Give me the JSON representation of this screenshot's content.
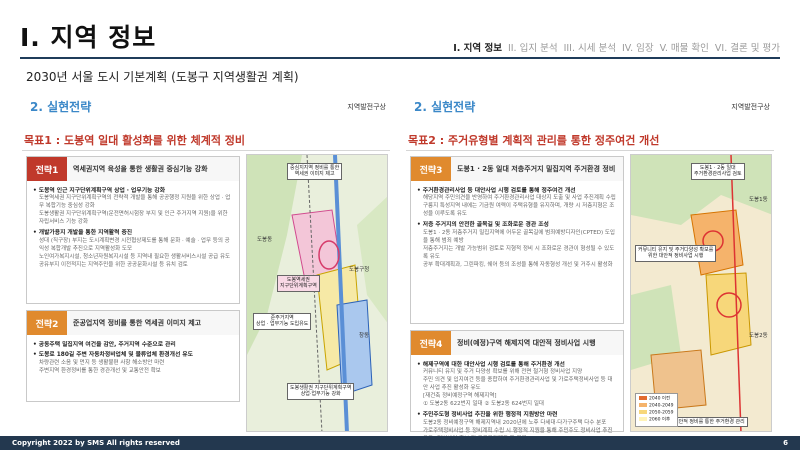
{
  "header": {
    "title": "I. 지역 정보",
    "nav": [
      "I. 지역 정보",
      "II. 입지 분석",
      "III. 시세 분석",
      "IV. 임장",
      "V. 매물 확인",
      "VI. 결론 및 평가"
    ]
  },
  "subtitle": "2030년 서울 도시 기본계획 (도봉구 지역생활권 계획)",
  "left": {
    "strategy": "2. 실현전략",
    "tag": "지역발전구상",
    "goal": "목표1 : 도봉역 일대 활성화를 위한 체계적 정비",
    "box1": {
      "num": "전략1",
      "name": "역세권지역 육성을 통한 생활권 중심기능 강화",
      "items": [
        "도봉역 인근 지구단위계획구역 상업 · 업무기능 강화",
        "도봉역세권 지구단위계획구역의 전략적 개발을 통해 공공행정 지원을 위한 상업 · 업무 복합기능 중심성 강화",
        "도봉생활권 지구단위계획구역(운전면허시험장 부지 및 인근 주거지역 지원)을 위한 자립서비스 기능 강화",
        "개발가용지 개발을 통한 지역활력 증진",
        "성대 (직구장) 부지는 도시계획변경 시전협상제도를 통해 문화 · 예술 · 업무 등의 공익성 복합개발 추진으로 지역활성화 도모",
        "노인여가복지시설, 청소년자원복지시설 등 지역내 필요한 생활서비스시설 공급 유도",
        "공유부지 이전적지는 지역주민을 위한 공공문화시설 등 유치 검토"
      ]
    },
    "box2": {
      "num": "전략2",
      "name": "준공업지역 정비를 통한 역세권 이미지 제고",
      "items": [
        "공동주택 밀집지역 여건을 감안, 주거지역 수준으로 관리",
        "도봉로 180길 주변 자동차정비업체 및 물류업체 환경개선 유도",
        "차량관련 소음 및 먼지 등 생활불편 사항 해소방안 마련",
        "주변지역 환경정비를 통한 경관개선 및 교통안전 확보"
      ]
    },
    "map": {
      "labels": [
        "중심지지역 정비를 통한\n역세권 이미지 제고",
        "준주거지역\n상업 · 업무기능 도입유도",
        "도봉역세권\n지구단위계획구역",
        "도봉생활권 지구단위계획구역\n상업·업무기능 강화",
        "도봉구청",
        "도봉동",
        "창동"
      ]
    }
  },
  "right": {
    "strategy": "2. 실현전략",
    "tag": "지역발전구상",
    "goal": "목표2 : 주거유형별 계획적 관리를 통한 정주여건 개선",
    "box3": {
      "num": "전략3",
      "name": "도봉1 · 2동 일대 저층주거지 밀집지역 주거환경 정비",
      "items": [
        "주거환경관리사업 등 대안사업 시행 검토를 통해 정주여건 개선",
        "해당지역 주민의견을 반영하여 주거환경관리사업 대상지 도출 및 사업 추진계획 수립",
        "구릉지 특성지역 내에는 기금원 여력이 주택유형을 유지하며, 개량 시 저층지형은 조성을 이루도록 유도",
        "저층 주거지의 안전한 골목길 및 조화로운 경관 조성",
        "도봉1 · 2동 저층주거지 밀집지역에 어두운 골목길에 범죄예방디자인(CPTED) 도입을 통해 범죄 예방",
        "저층주거지는 개발 가능범위 검토로 지형적 정비 시 조화로운 경관이 형성될 수 있도록 유도",
        "공부 확대계획과, 그린파킹, 쉐어 등의 조성을 통해 자동형성 개선 및 거주시 활성화"
      ]
    },
    "box4": {
      "num": "전략4",
      "name": "정비(예정)구역 해제지역 대안적 정비사업 시행",
      "items": [
        "해제구역에 대한 대안사업 시행 검토를 통해 주거환경 개선",
        "커뮤니티 유지 및 주거 다양성 확보를 위해 전면 철거형 정비사업 지양",
        "주민 의견 및 입지여건 등을 종합하여 주거환경관리사업 및 가로주택정비사업 등 대안 사업 추진 활성화 유도",
        "[재건축 정비예정구역 해제지역]",
        "① 도봉2동 622번지 일대   ② 도봉2동 624번지 일대",
        "주민주도형 정비사업 추진을 위한 행정적 지원방안 마련",
        "도봉2동 정비예정구역 해제지역내 2020년에 노후 다세대·다가구주택 다수 분포",
        "가로주택정비사업 등 정비계획 수립 시 행정적 지원을 통해 주민주도 정비사업 추진 유도 (정비사업 홍보 및 공공관리제도 등 지원)"
      ]
    },
    "map": {
      "labels": [
        "도봉1 · 2동 일대\n주거환경관리사업 검토",
        "커뮤니티 유지 및 주거다양성 확보를\n위한 대안적 정비사업 시행",
        "대안적 정비를 통한 주거환경 관리",
        "도봉1동",
        "도봉2동"
      ],
      "legend": [
        "2040 이전",
        "2040-2049",
        "2050-2059",
        "2060 이후"
      ]
    }
  },
  "footer": {
    "copyright": "Copyright 2022 by SMS  All rights reserved",
    "page": "6"
  },
  "colors": {
    "accent": "#3b88c8",
    "goal": "#c0392b",
    "strategy_red": "#c0392b",
    "strategy_orange": "#e08a2e",
    "footer": "#23384f"
  }
}
